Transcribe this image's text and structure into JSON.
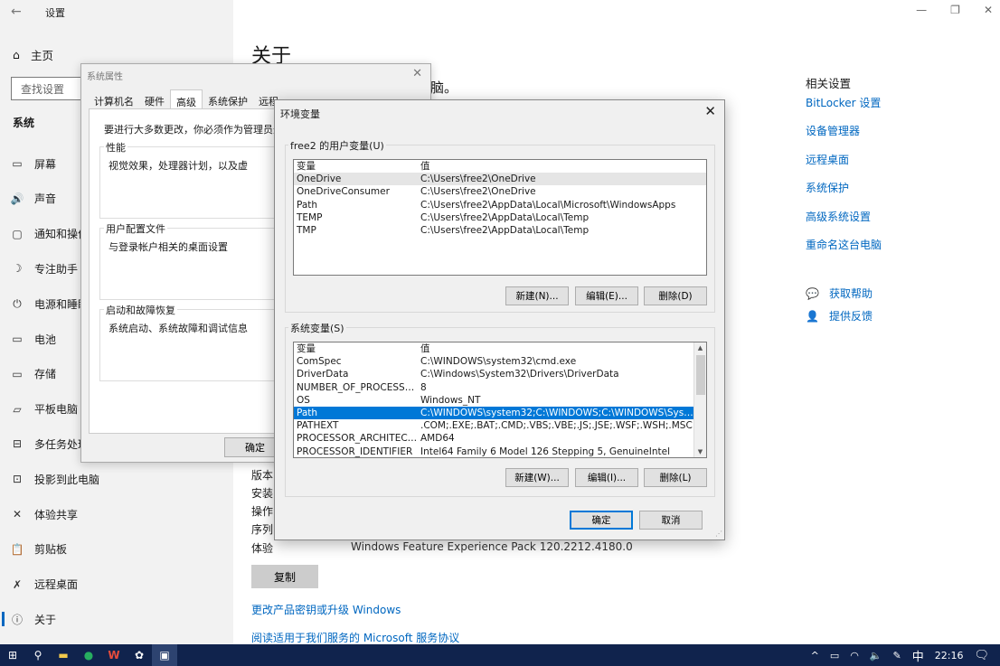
{
  "settings": {
    "window_title": "设置",
    "home_label": "主页",
    "search_placeholder": "查找设置",
    "section_title": "系统",
    "nav_items": [
      {
        "label": "屏幕",
        "icon": "monitor-icon"
      },
      {
        "label": "声音",
        "icon": "speaker-icon"
      },
      {
        "label": "通知和操作",
        "icon": "notification-icon"
      },
      {
        "label": "专注助手",
        "icon": "moon-icon"
      },
      {
        "label": "电源和睡眠",
        "icon": "power-icon"
      },
      {
        "label": "电池",
        "icon": "battery-icon"
      },
      {
        "label": "存储",
        "icon": "storage-icon"
      },
      {
        "label": "平板电脑",
        "icon": "tablet-icon"
      },
      {
        "label": "多任务处理",
        "icon": "multitask-icon"
      },
      {
        "label": "投影到此电脑",
        "icon": "project-icon"
      },
      {
        "label": "体验共享",
        "icon": "share-icon"
      },
      {
        "label": "剪贴板",
        "icon": "clipboard-icon"
      },
      {
        "label": "远程桌面",
        "icon": "remote-icon"
      },
      {
        "label": "关于",
        "icon": "info-icon"
      }
    ],
    "page_title": "关于",
    "partial_heading": "脑。",
    "specs": [
      {
        "label": "版本",
        "value": ""
      },
      {
        "label": "安装",
        "value": ""
      },
      {
        "label": "操作",
        "value": ""
      },
      {
        "label": "序列",
        "value": ""
      },
      {
        "label": "体验",
        "value": "Windows Feature Experience Pack 120.2212.4180.0"
      }
    ],
    "copy_button": "复制",
    "links": [
      "更改产品密钥或升级 Windows",
      "阅读适用于我们服务的 Microsoft 服务协议"
    ],
    "related_title": "相关设置",
    "related_links": [
      "BitLocker 设置",
      "设备管理器",
      "远程桌面",
      "系统保护",
      "高级系统设置",
      "重命名这台电脑"
    ],
    "help_links": [
      "获取帮助",
      "提供反馈"
    ]
  },
  "sysprop": {
    "title": "系统属性",
    "tabs": [
      "计算机名",
      "硬件",
      "高级",
      "系统保护",
      "远程"
    ],
    "admin_note": "要进行大多数更改，你必须作为管理员登录。",
    "groups": [
      {
        "label": "性能",
        "text": "视觉效果，处理器计划，以及虚"
      },
      {
        "label": "用户配置文件",
        "text": "与登录帐户相关的桌面设置"
      },
      {
        "label": "启动和故障恢复",
        "text": "系统启动、系统故障和调试信息"
      }
    ],
    "ok": "确定"
  },
  "env": {
    "title": "环境变量",
    "user_group_label": "free2 的用户变量(U)",
    "col_var": "变量",
    "col_val": "值",
    "user_vars": [
      {
        "name": "OneDrive",
        "value": "C:\\Users\\free2\\OneDrive"
      },
      {
        "name": "OneDriveConsumer",
        "value": "C:\\Users\\free2\\OneDrive"
      },
      {
        "name": "Path",
        "value": "C:\\Users\\free2\\AppData\\Local\\Microsoft\\WindowsApps"
      },
      {
        "name": "TEMP",
        "value": "C:\\Users\\free2\\AppData\\Local\\Temp"
      },
      {
        "name": "TMP",
        "value": "C:\\Users\\free2\\AppData\\Local\\Temp"
      }
    ],
    "user_buttons": [
      "新建(N)...",
      "编辑(E)...",
      "删除(D)"
    ],
    "sys_group_label": "系统变量(S)",
    "sys_vars": [
      {
        "name": "ComSpec",
        "value": "C:\\WINDOWS\\system32\\cmd.exe"
      },
      {
        "name": "DriverData",
        "value": "C:\\Windows\\System32\\Drivers\\DriverData"
      },
      {
        "name": "NUMBER_OF_PROCESSORS",
        "value": "8"
      },
      {
        "name": "OS",
        "value": "Windows_NT"
      },
      {
        "name": "Path",
        "value": "C:\\WINDOWS\\system32;C:\\WINDOWS;C:\\WINDOWS\\System3..."
      },
      {
        "name": "PATHEXT",
        "value": ".COM;.EXE;.BAT;.CMD;.VBS;.VBE;.JS;.JSE;.WSF;.WSH;.MSC"
      },
      {
        "name": "PROCESSOR_ARCHITECTU...",
        "value": "AMD64"
      },
      {
        "name": "PROCESSOR_IDENTIFIER",
        "value": "Intel64 Family 6 Model 126 Stepping 5, GenuineIntel"
      }
    ],
    "sys_buttons": [
      "新建(W)...",
      "编辑(I)...",
      "删除(L)"
    ],
    "ok": "确定",
    "cancel": "取消"
  },
  "taskbar": {
    "ime": "中",
    "time": "22:16"
  },
  "colors": {
    "accent": "#0067c0",
    "selection": "#0078d7",
    "taskbar": "#10234d"
  }
}
